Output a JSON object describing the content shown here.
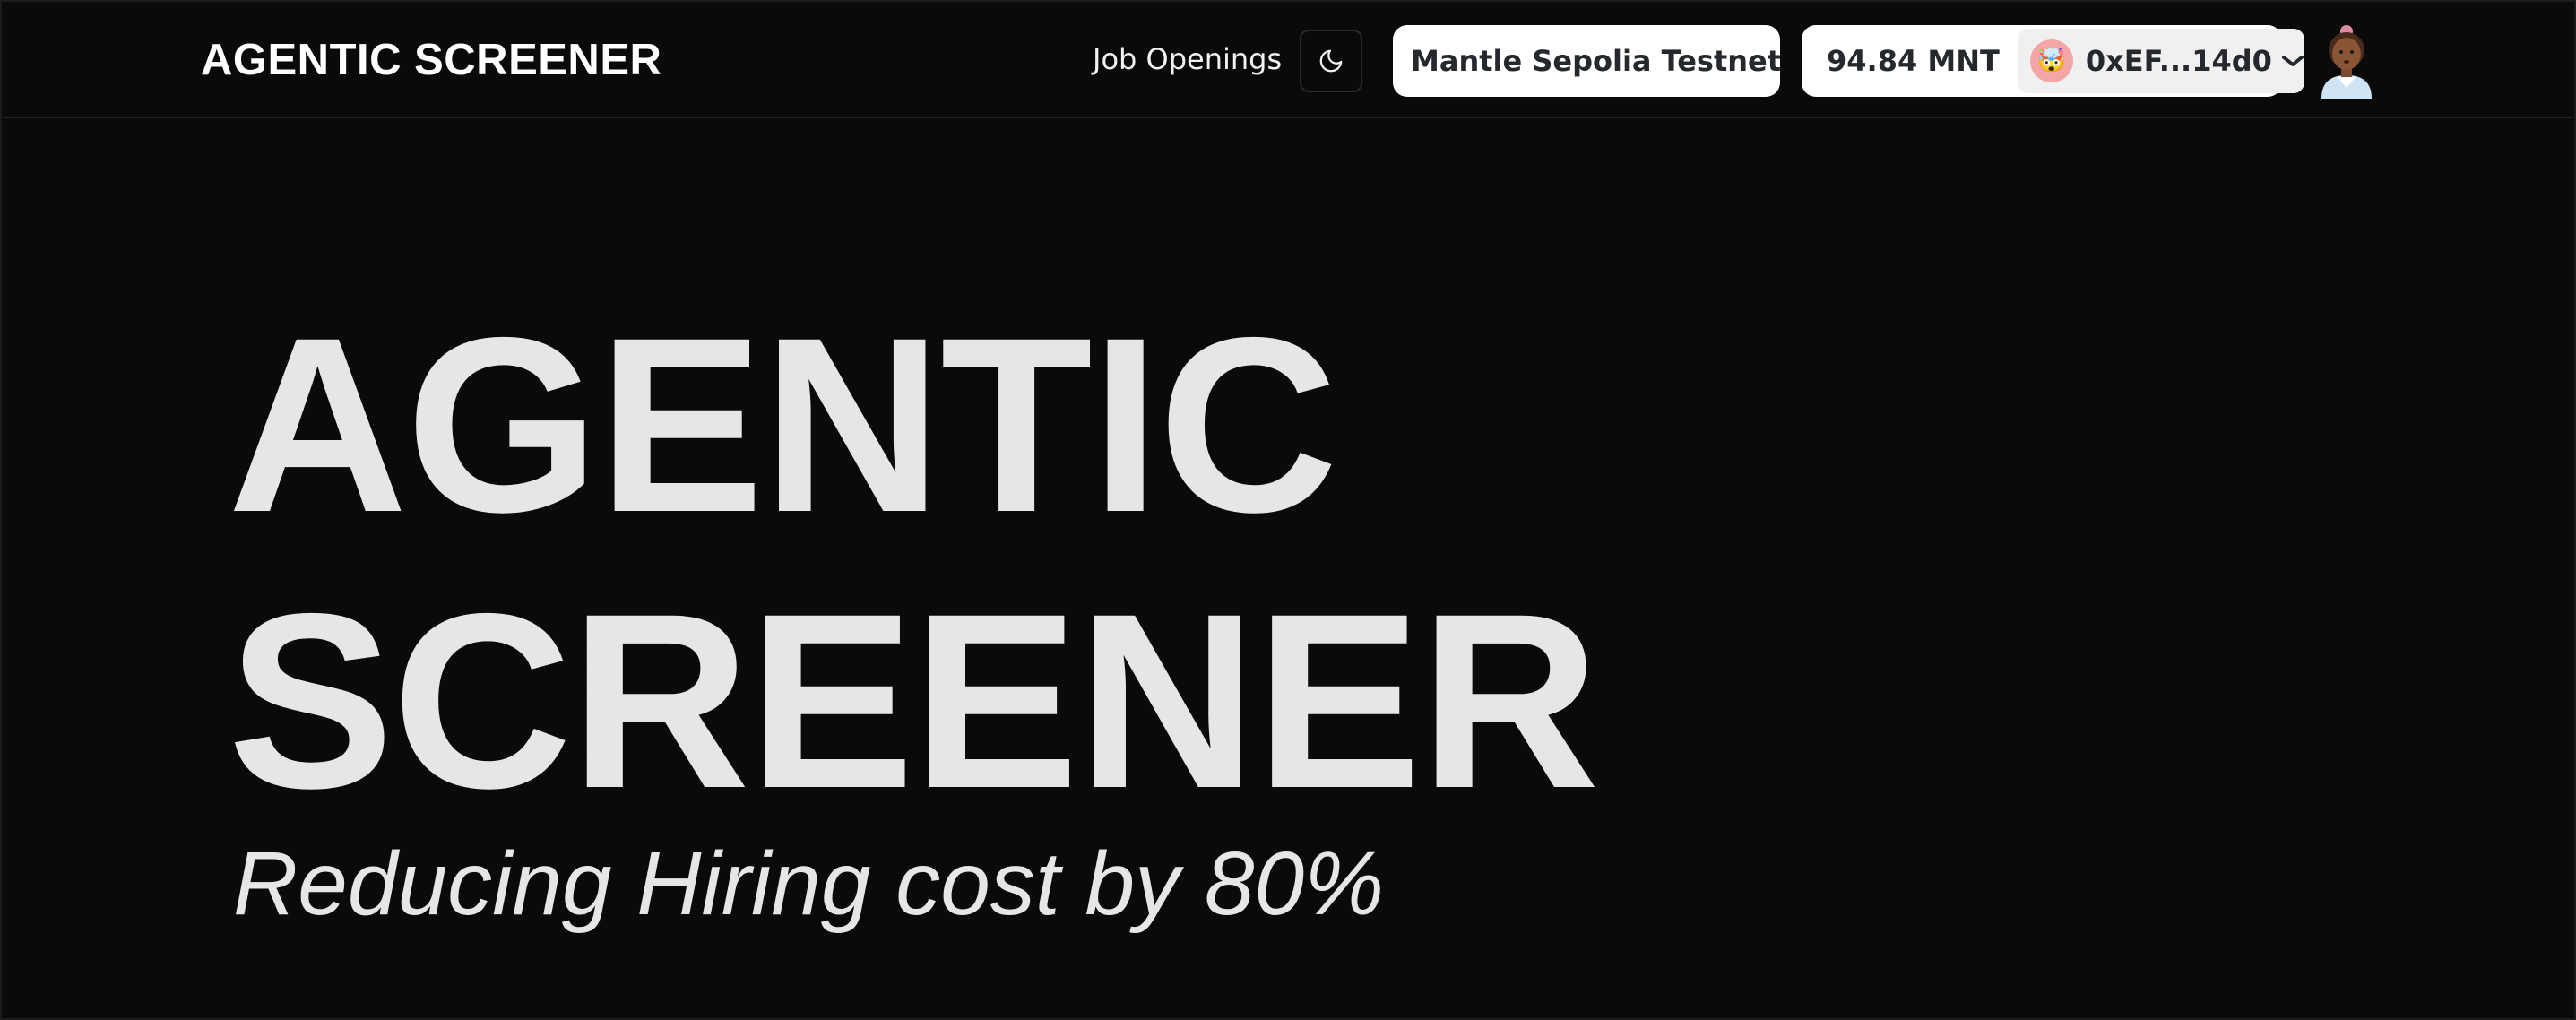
{
  "navbar": {
    "brand": "AGENTIC SCREENER",
    "job_openings_label": "Job Openings",
    "theme_toggle_icon": "moon-icon",
    "network": {
      "name": "Mantle Sepolia Testnet",
      "icon": "chevron-down-icon"
    },
    "wallet": {
      "balance": "94.84 MNT",
      "account_emoji": "🤯",
      "address": "0xEF...14d0",
      "icon": "chevron-down-icon"
    },
    "profile_icon": "avatar-icon"
  },
  "hero": {
    "title_line1": "AGENTIC",
    "title_line2": "SCREENER",
    "subtitle": "Reducing Hiring cost by 80%"
  },
  "colors": {
    "background": "#0a0a0a",
    "text": "#e6e6e6",
    "pill_bg": "#ffffff",
    "pill_text": "#25292e",
    "account_avatar_bg": "#f4a6a6"
  }
}
